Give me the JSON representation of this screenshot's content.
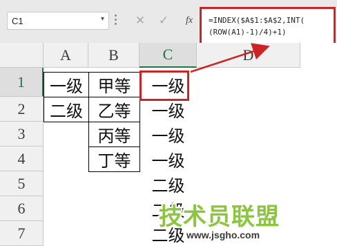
{
  "formula_bar": {
    "name_box": "C1",
    "name_box_arrow": "▾",
    "cancel_icon": "✕",
    "enter_icon": "✓",
    "fx_label": "fx",
    "formula_line1": "=INDEX($A$1:$A$2,INT(",
    "formula_line2": "(ROW(A1)-1)/4)+1)"
  },
  "columns": [
    "A",
    "B",
    "C",
    "D"
  ],
  "rows": [
    "1",
    "2",
    "3",
    "4",
    "5",
    "6",
    "7"
  ],
  "cells": {
    "A1": "一级",
    "A2": "二级",
    "B1": "甲等",
    "B2": "乙等",
    "B3": "丙等",
    "B4": "丁等",
    "C1": "一级",
    "C2": "一级",
    "C3": "一级",
    "C4": "一级",
    "C5": "二级",
    "C6": "二级",
    "C7": "二级"
  },
  "watermark": {
    "text": "技术员联盟",
    "url": "www.jsgho.com"
  },
  "colors": {
    "highlight_red": "#cc2325",
    "excel_green": "#217346",
    "watermark_green": "#8cc63f"
  }
}
